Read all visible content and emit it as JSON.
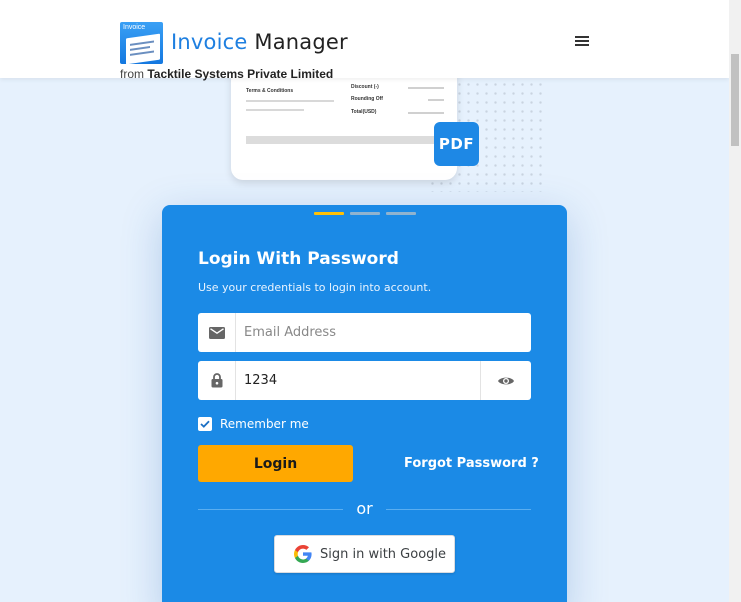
{
  "header": {
    "logo_tag": "Invoice",
    "brand_primary": "Invoice",
    "brand_secondary": "Manager",
    "byline_from": "from",
    "byline_company": "Tacktile Systems Private Limited",
    "menu_icon": "hamburger-menu-icon"
  },
  "illustration": {
    "terms_label": "Terms & Conditions",
    "rows": [
      "Discount (-)",
      "Rounding Off",
      "Total(USD)"
    ],
    "badge": "PDF"
  },
  "login": {
    "carousel_dots": 3,
    "active_dot": 0,
    "title": "Login With Password",
    "subtitle": "Use your credentials to login into account.",
    "email": {
      "placeholder": "Email Address",
      "value": "",
      "icon": "mail-icon"
    },
    "password": {
      "value": "1234",
      "icon": "lock-icon",
      "toggle_icon": "eye-icon"
    },
    "remember_label": "Remember me",
    "remember_checked": true,
    "login_label": "Login",
    "forgot_label": "Forgot Password ?",
    "or_label": "or",
    "google_label": "Sign in with Google"
  },
  "colors": {
    "card_blue": "#1b8ae6",
    "brand_blue": "#1e7fe0",
    "login_button": "#ffa800",
    "active_dot": "#ffc107",
    "page_bg": "#e6f1fd"
  }
}
